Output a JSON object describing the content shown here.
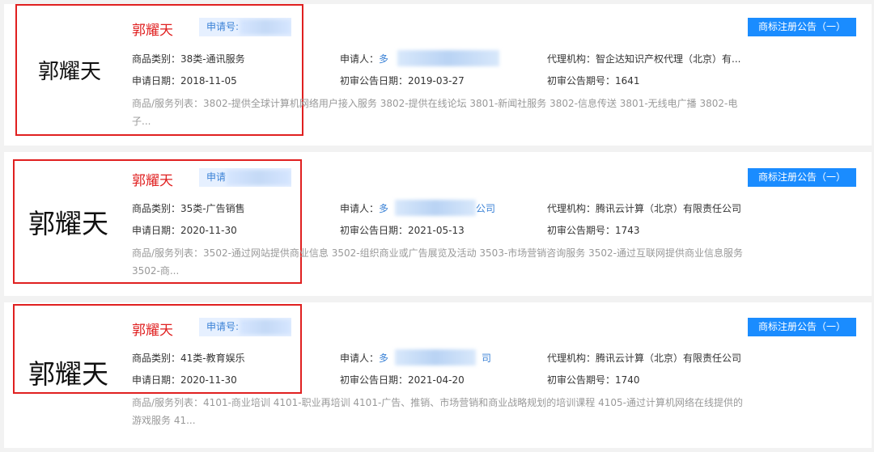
{
  "cards": [
    {
      "logo_text": "郭耀天",
      "name": "郭耀天",
      "appno_label": "申请号: 3",
      "notice_button": "商标注册公告（一）",
      "category_label": "商品类别：",
      "category": "38类-通讯服务",
      "applicant_label": "申请人：",
      "applicant": "多",
      "agency_label": "代理机构：",
      "agency": "智企达知识产权代理（北京）有...",
      "apply_date_label": "申请日期：",
      "apply_date": "2018-11-05",
      "pub_date_label": "初审公告日期：",
      "pub_date": "2019-03-27",
      "pub_issue_label": "初审公告期号：",
      "pub_issue": "1641",
      "services_label": "商品/服务列表：",
      "services": "3802-提供全球计算机网络用户接入服务 3802-提供在线论坛 3801-新闻社服务 3802-信息传送 3801-无线电广播 3802-电子..."
    },
    {
      "logo_text": "郭耀天",
      "name": "郭耀天",
      "appno_label": "申请",
      "notice_button": "商标注册公告（一）",
      "category_label": "商品类别：",
      "category": "35类-广告销售",
      "applicant_label": "申请人：",
      "applicant": "多",
      "applicant_tail": "公司",
      "agency_label": "代理机构：",
      "agency": "腾讯云计算（北京）有限责任公司",
      "apply_date_label": "申请日期：",
      "apply_date": "2020-11-30",
      "pub_date_label": "初审公告日期：",
      "pub_date": "2021-05-13",
      "pub_issue_label": "初审公告期号：",
      "pub_issue": "1743",
      "services_label": "商品/服务列表：",
      "services": "3502-通过网站提供商业信息 3502-组织商业或广告展览及活动 3503-市场营销咨询服务 3502-通过互联网提供商业信息服务 3502-商..."
    },
    {
      "logo_text": "郭耀天",
      "name": "郭耀天",
      "appno_label": "申请号: 5",
      "notice_button": "商标注册公告（一）",
      "category_label": "商品类别：",
      "category": "41类-教育娱乐",
      "applicant_label": "申请人：",
      "applicant": "多",
      "applicant_tail": "司",
      "agency_label": "代理机构：",
      "agency": "腾讯云计算（北京）有限责任公司",
      "apply_date_label": "申请日期：",
      "apply_date": "2020-11-30",
      "pub_date_label": "初审公告日期：",
      "pub_date": "2021-04-20",
      "pub_issue_label": "初审公告期号：",
      "pub_issue": "1740",
      "services_label": "商品/服务列表：",
      "services": "4101-商业培训 4101-职业再培训 4101-广告、推销、市场营销和商业战略规划的培训课程 4105-通过计算机网络在线提供的游戏服务 41..."
    }
  ],
  "colors": {
    "accent_red": "#e02020",
    "button_blue": "#1a8cff",
    "appno_bg": "#e6f0ff",
    "appno_text": "#3b82d6"
  }
}
